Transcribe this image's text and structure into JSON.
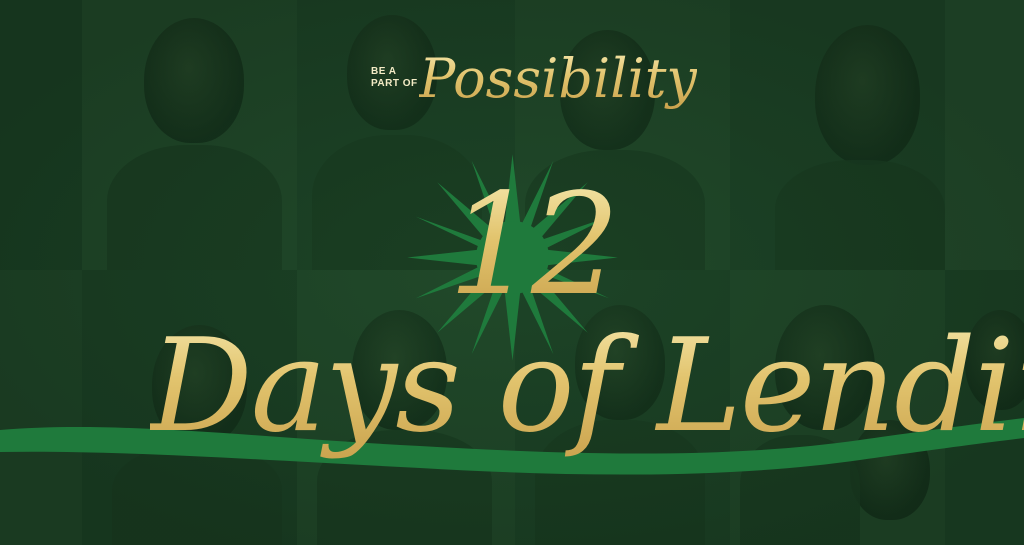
{
  "prefix_line1": "BE A",
  "prefix_line2": "PART OF",
  "script_word": "Possibility",
  "number": "12",
  "headline": "Days of Lending",
  "colors": {
    "background": "#1a3d22",
    "gold_light": "#f7ecb4",
    "gold_dark": "#c79f4a",
    "accent_green": "#1f7a3c"
  }
}
